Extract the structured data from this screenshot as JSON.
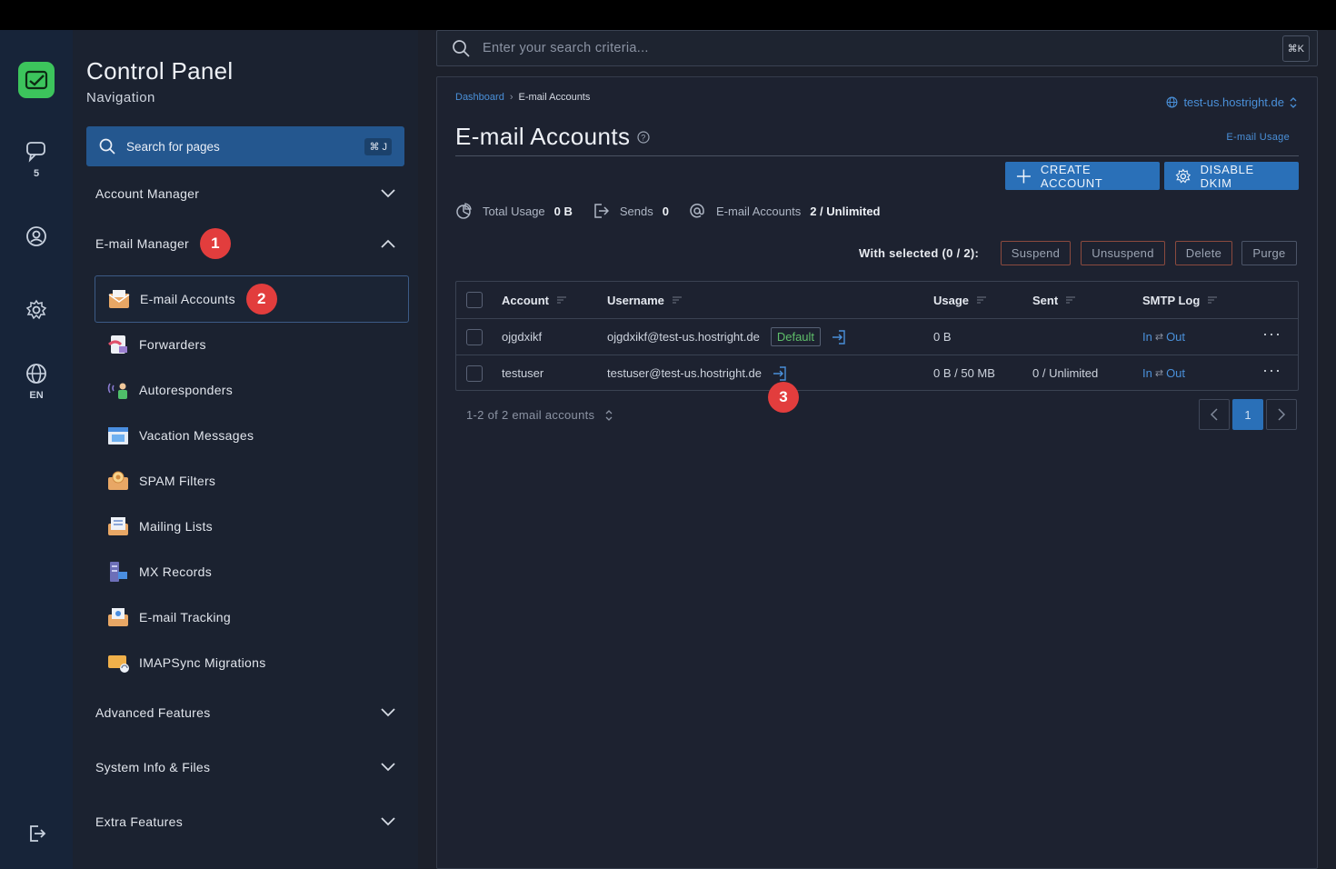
{
  "app": {
    "title": "Control Panel",
    "subtitle": "Navigation"
  },
  "rail": {
    "messages_count": "5",
    "language": "EN"
  },
  "sidebar": {
    "search_label": "Search for pages",
    "search_shortcut": "⌘ J",
    "sections": [
      {
        "label": "Account Manager"
      },
      {
        "label": "E-mail Manager",
        "badge": "1"
      },
      {
        "label": "Advanced Features"
      },
      {
        "label": "System Info & Files"
      },
      {
        "label": "Extra Features"
      }
    ],
    "email_items": [
      {
        "label": "E-mail Accounts",
        "badge": "2",
        "icon": "email-accounts-icon"
      },
      {
        "label": "Forwarders",
        "icon": "forwarders-icon"
      },
      {
        "label": "Autoresponders",
        "icon": "autoresponders-icon"
      },
      {
        "label": "Vacation Messages",
        "icon": "vacation-messages-icon"
      },
      {
        "label": "SPAM Filters",
        "icon": "spam-filters-icon"
      },
      {
        "label": "Mailing Lists",
        "icon": "mailing-lists-icon"
      },
      {
        "label": "MX Records",
        "icon": "mx-records-icon"
      },
      {
        "label": "E-mail Tracking",
        "icon": "email-tracking-icon"
      },
      {
        "label": "IMAPSync Migrations",
        "icon": "imapsync-icon"
      }
    ]
  },
  "search": {
    "placeholder": "Enter your search criteria...",
    "shortcut": "⌘K"
  },
  "breadcrumb": {
    "home": "Dashboard",
    "current": "E-mail Accounts"
  },
  "domain": "test-us.hostright.de",
  "page": {
    "title": "E-mail Accounts",
    "usage_link": "E-mail Usage"
  },
  "buttons": {
    "create": "CREATE ACCOUNT",
    "disable_dkim": "DISABLE DKIM"
  },
  "stats": {
    "total_usage_label": "Total Usage",
    "total_usage_value": "0 B",
    "sends_label": "Sends",
    "sends_value": "0",
    "accounts_label": "E-mail Accounts",
    "accounts_value": "2 / Unlimited"
  },
  "bulk": {
    "label": "With selected (0 / 2):",
    "suspend": "Suspend",
    "unsuspend": "Unsuspend",
    "delete": "Delete",
    "purge": "Purge"
  },
  "table": {
    "headers": {
      "account": "Account",
      "username": "Username",
      "usage": "Usage",
      "sent": "Sent",
      "smtp": "SMTP Log"
    },
    "rows": [
      {
        "account": "ojgdxikf",
        "username": "ojgdxikf@test-us.hostright.de",
        "tag": "Default",
        "usage": "0 B",
        "sent": "",
        "in": "In",
        "arrow": "⇄",
        "out": "Out"
      },
      {
        "account": "testuser",
        "username": "testuser@test-us.hostright.de",
        "usage": "0 B / 50 MB",
        "sent": "0 / Unlimited",
        "in": "In",
        "arrow": "⇄",
        "out": "Out",
        "badge": "3"
      }
    ]
  },
  "pagination": {
    "summary": "1-2 of 2 email accounts",
    "current_page": "1"
  },
  "colors": {
    "accent": "#2a70b8",
    "badge": "#e23d3d",
    "link": "#4a90d9",
    "success": "#5fbf6a"
  }
}
